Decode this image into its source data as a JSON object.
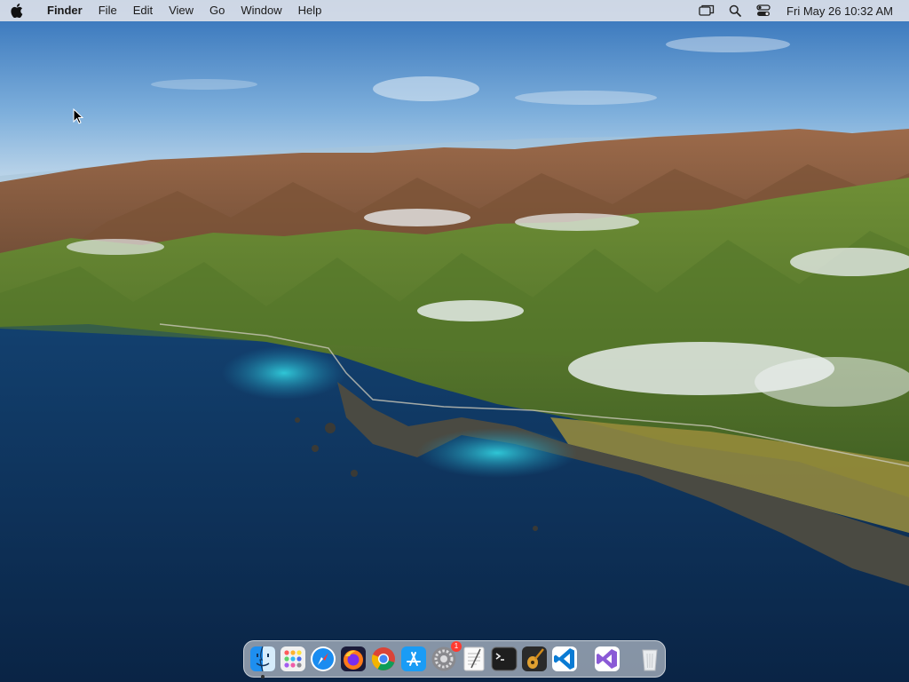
{
  "menubar": {
    "app_name": "Finder",
    "menus": [
      "File",
      "Edit",
      "View",
      "Go",
      "Window",
      "Help"
    ],
    "status_icons": [
      "screen-mirroring-icon",
      "spotlight-search-icon",
      "control-center-icon"
    ],
    "clock": "Fri May 26  10:32 AM"
  },
  "dock": {
    "apps": [
      {
        "name": "finder",
        "icon": "finder-icon",
        "running": true
      },
      {
        "name": "launchpad",
        "icon": "launchpad-icon"
      },
      {
        "name": "safari",
        "icon": "safari-icon"
      },
      {
        "name": "firefox",
        "icon": "firefox-icon"
      },
      {
        "name": "chrome",
        "icon": "chrome-icon"
      },
      {
        "name": "app-store",
        "icon": "app-store-icon"
      },
      {
        "name": "system-preferences",
        "icon": "system-preferences-icon",
        "badge": "1"
      },
      {
        "name": "textedit",
        "icon": "textedit-icon"
      },
      {
        "name": "terminal",
        "icon": "terminal-icon"
      },
      {
        "name": "garageband",
        "icon": "garageband-icon"
      },
      {
        "name": "vscode",
        "icon": "vscode-icon"
      },
      {
        "name": "visual-studio",
        "icon": "visual-studio-icon"
      },
      {
        "name": "trash",
        "icon": "trash-icon"
      }
    ]
  },
  "colors": {
    "menubar_bg": "#e8e8ec",
    "sky_top": "#3d7fc4",
    "ocean": "#0f3a66",
    "lagoon": "#22b0c8",
    "hills_green": "#5f7f2e",
    "mountains_brown": "#8a5a3a"
  }
}
